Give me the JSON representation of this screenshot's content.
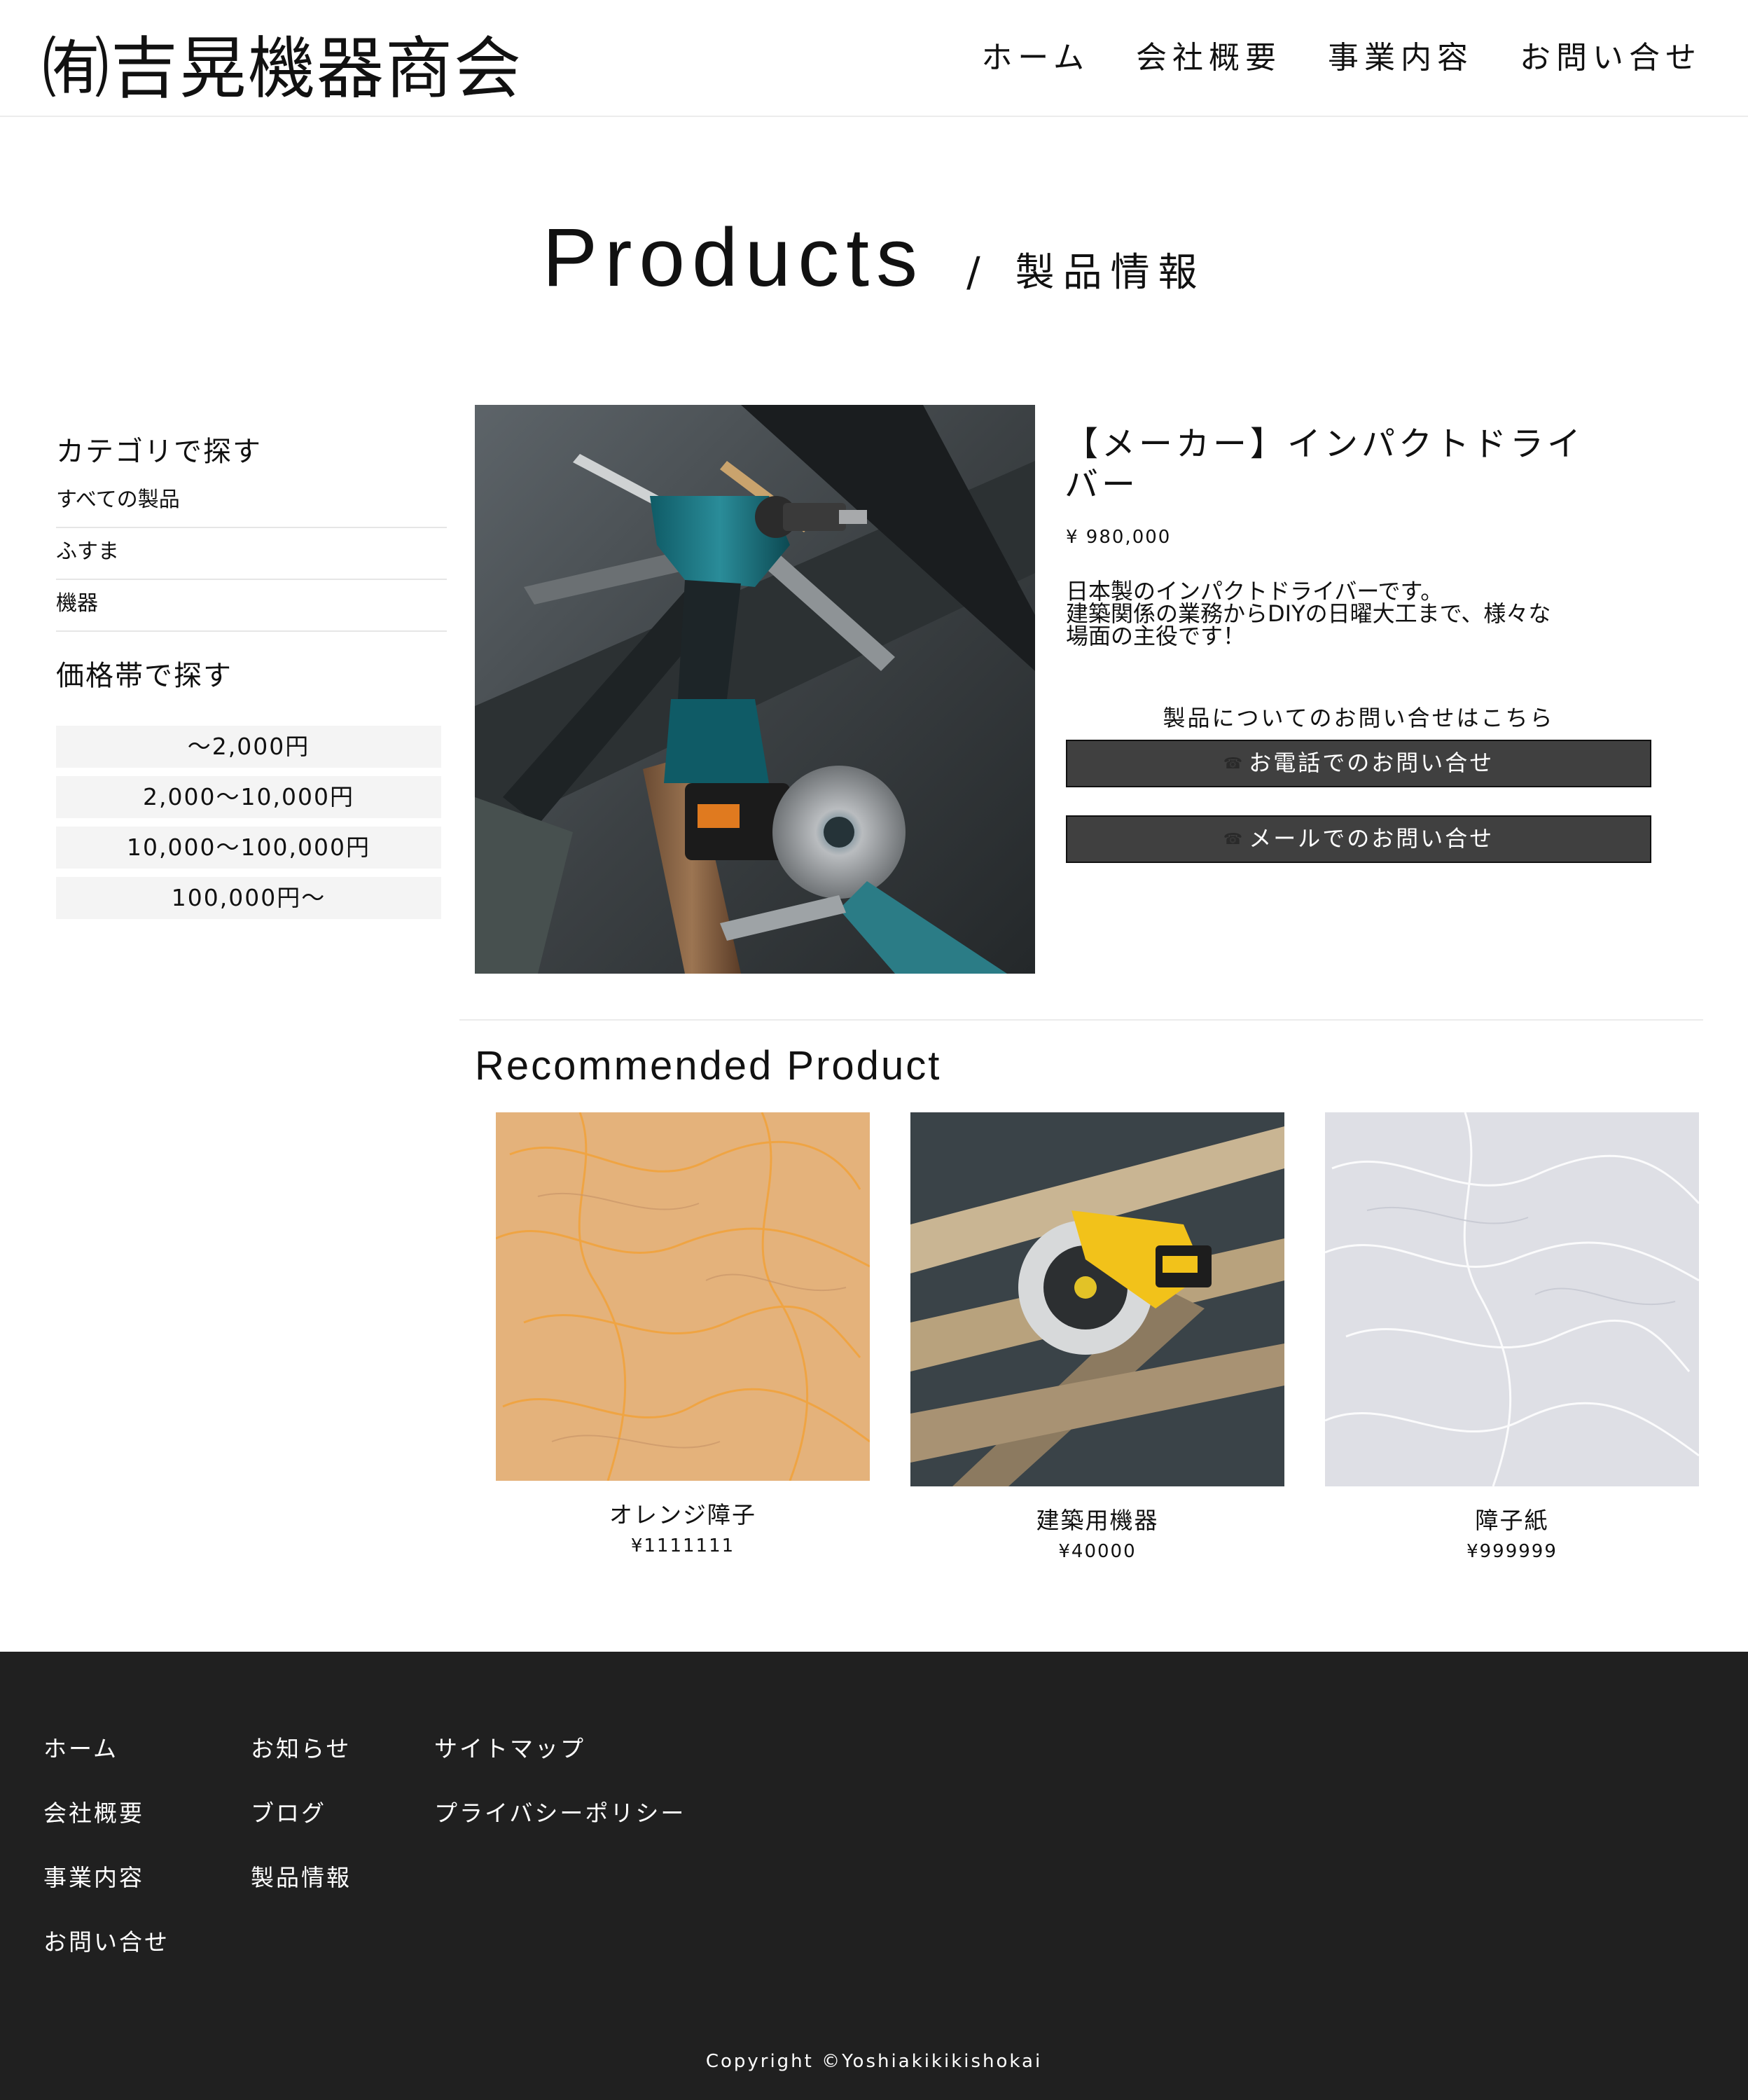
{
  "header": {
    "logo": "㈲吉晃機器商会",
    "nav": [
      "ホーム",
      "会社概要",
      "事業内容",
      "お問い合せ"
    ]
  },
  "page_title": {
    "en": "Products",
    "separator": "/",
    "jp": "製品情報"
  },
  "sidebar": {
    "category_heading": "カテゴリで探す",
    "categories": [
      "すべての製品",
      "ふすま",
      "機器"
    ],
    "price_heading": "価格帯で探す",
    "price_ranges": [
      "〜2,000円",
      "2,000〜10,000円",
      "10,000〜100,000円",
      "100,000円〜"
    ]
  },
  "product": {
    "title": "【メーカー】インパクトドライバー",
    "price": "¥ 980,000",
    "description": [
      "日本製のインパクトドライバーです。",
      "建築関係の業務からDIYの日曜大工まで、様々な",
      "場面の主役です！"
    ],
    "inquiry_label": "製品についてのお問い合せはこちら",
    "phone_button": "お電話でのお問い合せ",
    "mail_button": "メールでのお問い合せ",
    "icons": {
      "phone": "phone-icon",
      "mail": "phone-icon"
    }
  },
  "recommended": {
    "heading": "Recommended Product",
    "items": [
      {
        "name": "オレンジ障子",
        "price": "¥1111111"
      },
      {
        "name": "建築用機器",
        "price": "¥40000"
      },
      {
        "name": "障子紙",
        "price": "¥999999"
      }
    ]
  },
  "footer": {
    "col1": [
      "ホーム",
      "会社概要",
      "事業内容",
      "お問い合せ"
    ],
    "col2": [
      "お知らせ",
      "ブログ",
      "製品情報"
    ],
    "col3": [
      "サイトマップ",
      "プライバシーポリシー"
    ],
    "copyright": "Copyright ©Yoshiakikikishokai"
  },
  "colors": {
    "footer_bg": "#202020",
    "button_bg": "#404040",
    "price_btn_bg": "#f4f4f4"
  }
}
